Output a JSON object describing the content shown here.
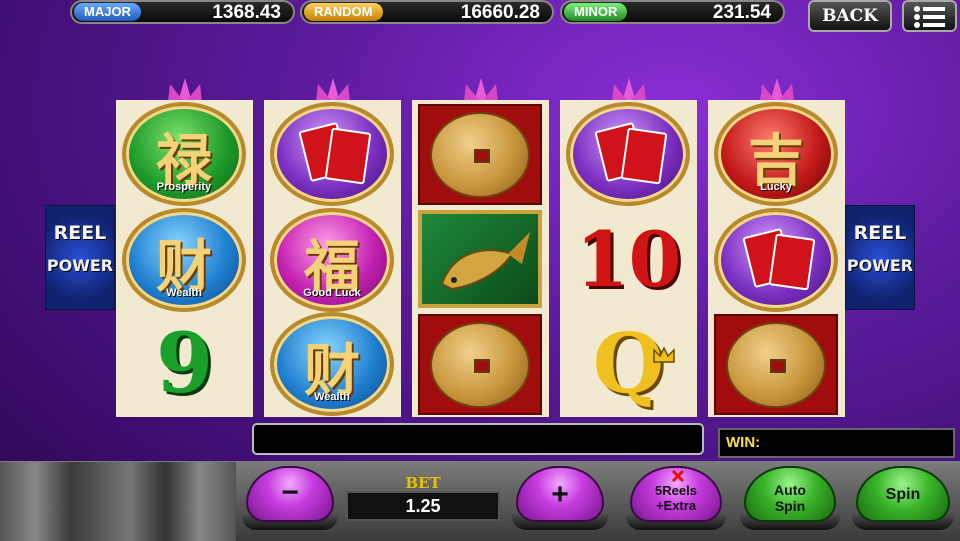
{
  "jackpots": {
    "major": {
      "label": "MAJOR",
      "value": "1368.43",
      "color": "#2d76d9"
    },
    "random": {
      "label": "RANDOM",
      "value": "16660.28",
      "color": "#d99a16"
    },
    "minor": {
      "label": "MINOR",
      "value": "231.54",
      "color": "#2ea83a"
    }
  },
  "top_buttons": {
    "back_label": "BACK",
    "menu_icon": "hamburger-menu-icon"
  },
  "side_logo": {
    "line1": "REEL",
    "line2": "POWER"
  },
  "reels": {
    "r1": {
      "c1_glyph": "禄",
      "c1_caption": "Prosperity",
      "c2_glyph": "财",
      "c2_caption": "Wealth",
      "c3_symbol": "9"
    },
    "r2": {
      "c2_glyph": "福",
      "c2_caption": "Good Luck",
      "c3_glyph": "财",
      "c3_caption": "Wealth"
    },
    "r4": {
      "c2_symbol": "10",
      "c3_symbol": "Q"
    },
    "r5": {
      "c1_glyph": "吉",
      "c1_caption": "Lucky"
    }
  },
  "win": {
    "label": "WIN:"
  },
  "controls": {
    "bet_label": "BET",
    "bet_value": "1.25",
    "minus_label": "−",
    "plus_label": "+",
    "reels_label_1": "5Reels",
    "reels_label_2": "+Extra",
    "auto_spin_1": "Auto",
    "auto_spin_2": "Spin",
    "spin_label": "Spin"
  }
}
